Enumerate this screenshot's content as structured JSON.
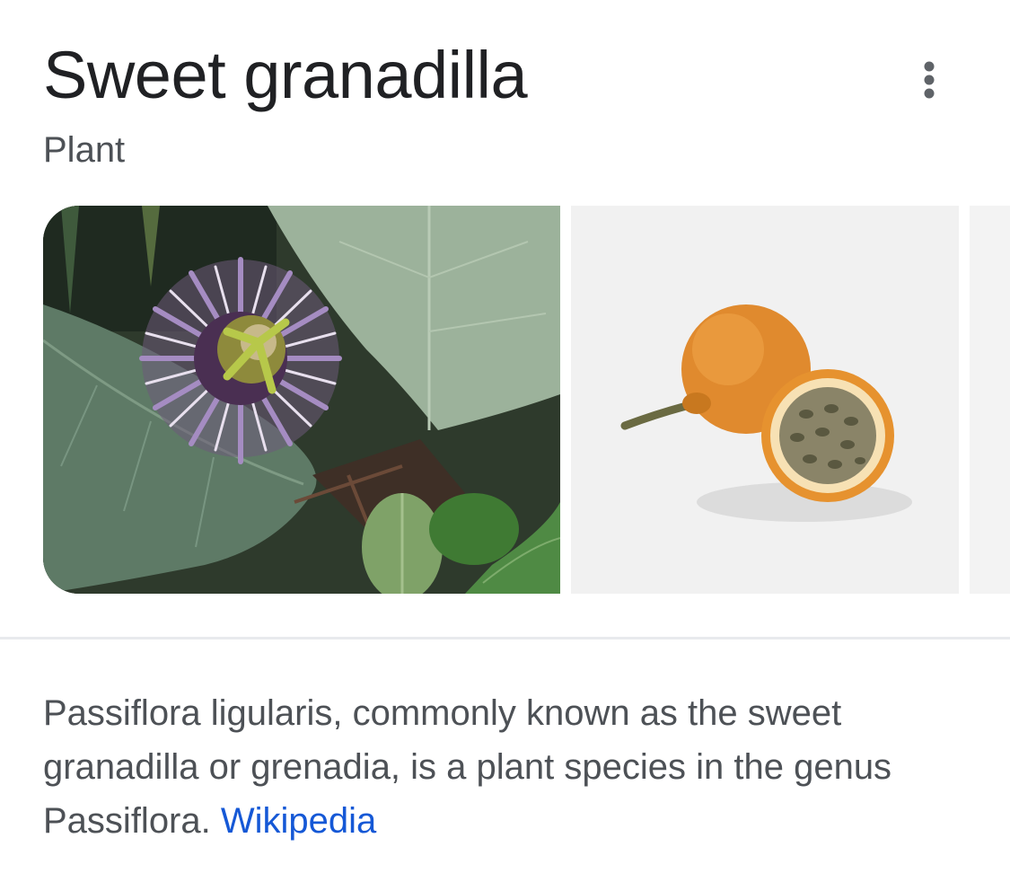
{
  "panel": {
    "title": "Sweet granadilla",
    "subtitle": "Plant",
    "more_icon": "more-vert-icon"
  },
  "images": [
    {
      "subject": "passion flower with leaves"
    },
    {
      "subject": "orange granadilla fruit, whole and halved"
    },
    {
      "subject": "partially visible third image"
    }
  ],
  "description": {
    "text": "Passiflora ligularis, commonly known as the sweet granadilla or grenadia, is a plant species in the genus Passiflora.",
    "source_link": "Wikipedia"
  },
  "colors": {
    "title": "#202124",
    "body_text": "#4d5156",
    "link": "#1558d6",
    "divider": "#e8eaed"
  }
}
